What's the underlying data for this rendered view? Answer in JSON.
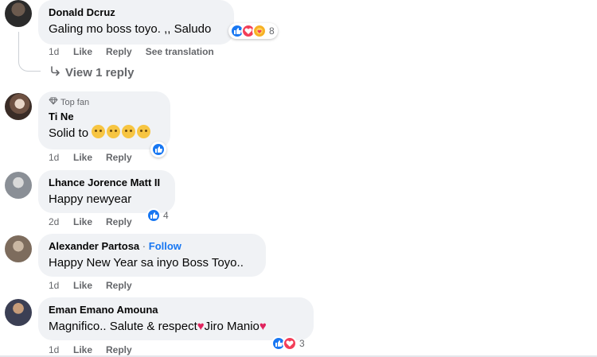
{
  "comments": [
    {
      "author": "Donald Dcruz",
      "text": "Galing mo boss toyo. ,, Saludo",
      "time": "1d",
      "like": "Like",
      "reply": "Reply",
      "extra": "See translation",
      "reaction_count": "8"
    },
    {
      "badge": "Top fan",
      "author": "Ti Ne",
      "text": "Solid to",
      "time": "1d",
      "like": "Like",
      "reply": "Reply"
    },
    {
      "author": "Lhance Jorence Matt II",
      "text": "Happy newyear",
      "time": "2d",
      "like": "Like",
      "reply": "Reply",
      "reaction_count": "4"
    },
    {
      "author": "Alexander Partosa",
      "separator": "·",
      "follow": "Follow",
      "text": "Happy New Year sa inyo Boss Toyo..",
      "time": "1d",
      "like": "Like",
      "reply": "Reply"
    },
    {
      "author": "Eman Emano Amouna",
      "text_before": "Magnifico.. Salute & respect",
      "text_after": "Jiro Manio",
      "time": "1d",
      "like": "Like",
      "reply": "Reply",
      "reaction_count": "3"
    }
  ],
  "view_reply": "View 1 reply",
  "colors": {
    "bubble": "#f0f2f5",
    "meta": "#65676b",
    "link": "#1877f2",
    "like": "#1877f2",
    "love": "#f33e58",
    "care": "#f7b125"
  }
}
